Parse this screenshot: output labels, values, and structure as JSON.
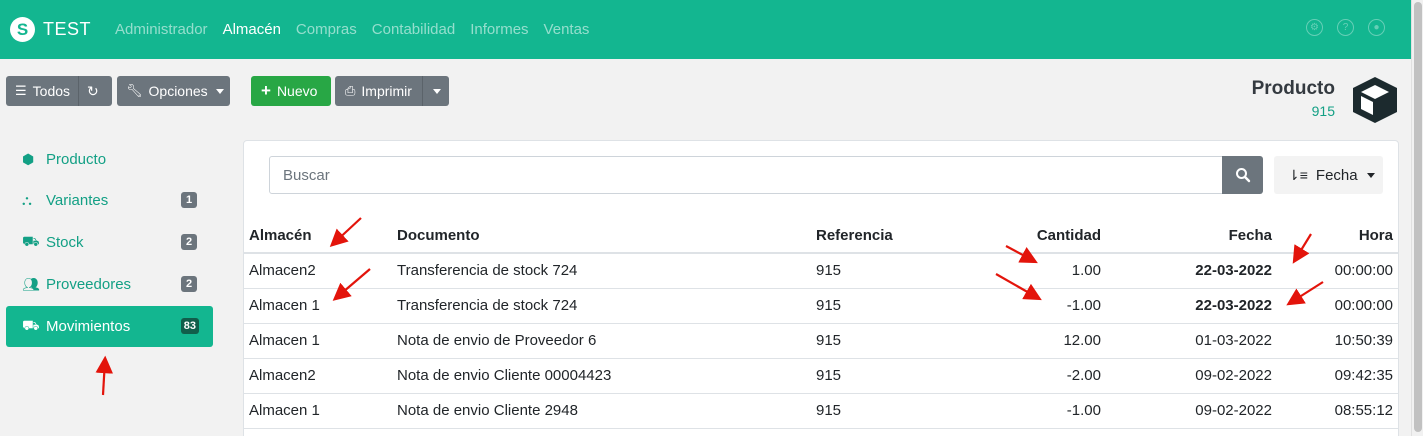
{
  "navbar": {
    "brand": "TEST",
    "brand_logo": "S",
    "links": [
      "Administrador",
      "Almacén",
      "Compras",
      "Contabilidad",
      "Informes",
      "Ventas"
    ],
    "active_link": "Almacén",
    "right_icons": [
      "gear-icon",
      "help-icon",
      "user-icon"
    ],
    "color": "#13b690"
  },
  "toolbar": {
    "todos_label": "Todos",
    "opciones_label": "Opciones",
    "nuevo_label": "Nuevo",
    "imprimir_label": "Imprimir"
  },
  "product": {
    "title": "Producto",
    "code": "915"
  },
  "sidebar": {
    "items": [
      {
        "label": "Producto",
        "icon": "cube-icon",
        "badge": ""
      },
      {
        "label": "Variantes",
        "icon": "sitemap-icon",
        "badge": "1"
      },
      {
        "label": "Stock",
        "icon": "dolly-icon",
        "badge": "2"
      },
      {
        "label": "Proveedores",
        "icon": "users-icon",
        "badge": "2"
      },
      {
        "label": "Movimientos",
        "icon": "truck-loading-icon",
        "badge": "83"
      }
    ],
    "active": "Movimientos"
  },
  "search": {
    "placeholder": "Buscar",
    "sort_label": "Fecha"
  },
  "table": {
    "headers": [
      "Almacén",
      "Documento",
      "Referencia",
      "Cantidad",
      "Fecha",
      "Hora"
    ],
    "rows": [
      [
        "Almacen2",
        "Transferencia de stock 724",
        "915",
        "1.00",
        "22-03-2022",
        "00:00:00"
      ],
      [
        "Almacen 1",
        "Transferencia de stock 724",
        "915",
        "-1.00",
        "22-03-2022",
        "00:00:00"
      ],
      [
        "Almacen 1",
        "Nota de envio de Proveedor 6",
        "915",
        "12.00",
        "01-03-2022",
        "10:50:39"
      ],
      [
        "Almacen2",
        "Nota de envio Cliente 00004423",
        "915",
        "-2.00",
        "09-02-2022",
        "09:42:35"
      ],
      [
        "Almacen 1",
        "Nota de envio Cliente 2948",
        "915",
        "-1.00",
        "09-02-2022",
        "08:55:12"
      ]
    ]
  },
  "colors": {
    "accent": "#13b690",
    "annotation_arrow": "#e3140b"
  }
}
